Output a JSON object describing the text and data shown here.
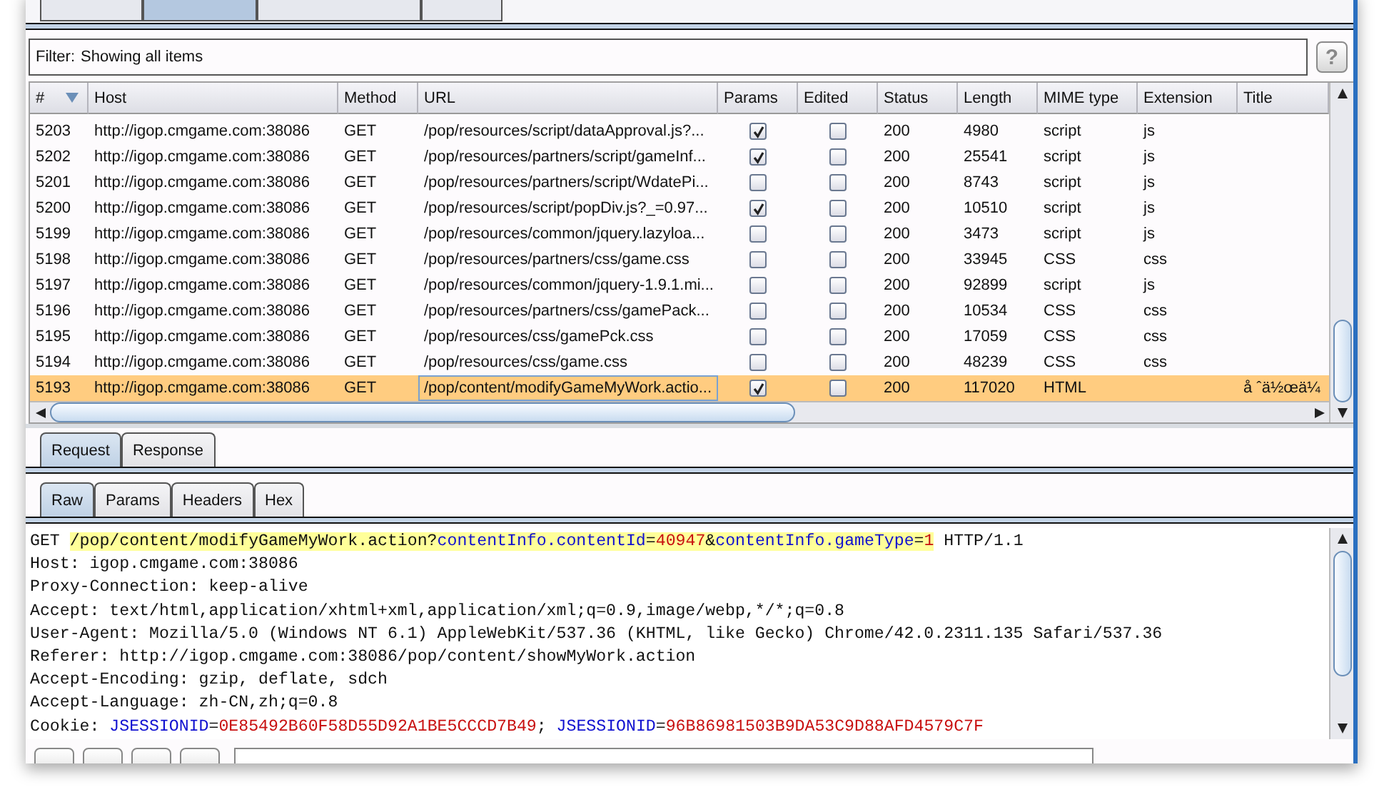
{
  "filter": {
    "label": "Filter:",
    "value": "Showing all items"
  },
  "help_button": "?",
  "top_tabs": [
    {
      "selected": false
    },
    {
      "selected": true
    },
    {
      "selected": false
    },
    {
      "selected": false
    }
  ],
  "table": {
    "columns": [
      {
        "label": "#",
        "sorted": true
      },
      {
        "label": "Host",
        "sorted": false
      },
      {
        "label": "Method",
        "sorted": false
      },
      {
        "label": "URL",
        "sorted": false
      },
      {
        "label": "Params",
        "sorted": false
      },
      {
        "label": "Edited",
        "sorted": false
      },
      {
        "label": "Status",
        "sorted": false
      },
      {
        "label": "Length",
        "sorted": false
      },
      {
        "label": "MIME type",
        "sorted": false
      },
      {
        "label": "Extension",
        "sorted": false
      },
      {
        "label": "Title",
        "sorted": false
      }
    ],
    "rows": [
      {
        "id": "5203",
        "host": "http://igop.cmgame.com:38086",
        "method": "GET",
        "url": "/pop/resources/script/dataApproval.js?...",
        "params": true,
        "edited": false,
        "status": "200",
        "length": "4980",
        "mime": "script",
        "extension": "js",
        "title": "",
        "selected": false
      },
      {
        "id": "5202",
        "host": "http://igop.cmgame.com:38086",
        "method": "GET",
        "url": "/pop/resources/partners/script/gameInf...",
        "params": true,
        "edited": false,
        "status": "200",
        "length": "25541",
        "mime": "script",
        "extension": "js",
        "title": "",
        "selected": false
      },
      {
        "id": "5201",
        "host": "http://igop.cmgame.com:38086",
        "method": "GET",
        "url": "/pop/resources/partners/script/WdatePi...",
        "params": false,
        "edited": false,
        "status": "200",
        "length": "8743",
        "mime": "script",
        "extension": "js",
        "title": "",
        "selected": false
      },
      {
        "id": "5200",
        "host": "http://igop.cmgame.com:38086",
        "method": "GET",
        "url": "/pop/resources/script/popDiv.js?_=0.97...",
        "params": true,
        "edited": false,
        "status": "200",
        "length": "10510",
        "mime": "script",
        "extension": "js",
        "title": "",
        "selected": false
      },
      {
        "id": "5199",
        "host": "http://igop.cmgame.com:38086",
        "method": "GET",
        "url": "/pop/resources/common/jquery.lazyloa...",
        "params": false,
        "edited": false,
        "status": "200",
        "length": "3473",
        "mime": "script",
        "extension": "js",
        "title": "",
        "selected": false
      },
      {
        "id": "5198",
        "host": "http://igop.cmgame.com:38086",
        "method": "GET",
        "url": "/pop/resources/partners/css/game.css",
        "params": false,
        "edited": false,
        "status": "200",
        "length": "33945",
        "mime": "CSS",
        "extension": "css",
        "title": "",
        "selected": false
      },
      {
        "id": "5197",
        "host": "http://igop.cmgame.com:38086",
        "method": "GET",
        "url": "/pop/resources/common/jquery-1.9.1.mi...",
        "params": false,
        "edited": false,
        "status": "200",
        "length": "92899",
        "mime": "script",
        "extension": "js",
        "title": "",
        "selected": false
      },
      {
        "id": "5196",
        "host": "http://igop.cmgame.com:38086",
        "method": "GET",
        "url": "/pop/resources/partners/css/gamePack...",
        "params": false,
        "edited": false,
        "status": "200",
        "length": "10534",
        "mime": "CSS",
        "extension": "css",
        "title": "",
        "selected": false
      },
      {
        "id": "5195",
        "host": "http://igop.cmgame.com:38086",
        "method": "GET",
        "url": "/pop/resources/css/gamePck.css",
        "params": false,
        "edited": false,
        "status": "200",
        "length": "17059",
        "mime": "CSS",
        "extension": "css",
        "title": "",
        "selected": false
      },
      {
        "id": "5194",
        "host": "http://igop.cmgame.com:38086",
        "method": "GET",
        "url": "/pop/resources/css/game.css",
        "params": false,
        "edited": false,
        "status": "200",
        "length": "48239",
        "mime": "CSS",
        "extension": "css",
        "title": "",
        "selected": false
      },
      {
        "id": "5193",
        "host": "http://igop.cmgame.com:38086",
        "method": "GET",
        "url": "/pop/content/modifyGameMyWork.actio...",
        "params": true,
        "edited": false,
        "status": "200",
        "length": "117020",
        "mime": "HTML",
        "extension": "",
        "title": "å ˆä½œä¼",
        "selected": true
      }
    ]
  },
  "message_tabs": [
    {
      "label": "Request",
      "selected": true
    },
    {
      "label": "Response",
      "selected": false
    }
  ],
  "view_tabs": [
    {
      "label": "Raw",
      "selected": true
    },
    {
      "label": "Params",
      "selected": false
    },
    {
      "label": "Headers",
      "selected": false
    },
    {
      "label": "Hex",
      "selected": false
    }
  ],
  "request_lines": [
    [
      {
        "text": "GET ",
        "kind": "plain",
        "highlighted": false
      },
      {
        "text": "/pop/content/modifyGameMyWork.action?",
        "kind": "plain",
        "highlighted": true
      },
      {
        "text": "contentInfo.contentId",
        "kind": "name",
        "highlighted": true
      },
      {
        "text": "=",
        "kind": "plain",
        "highlighted": true
      },
      {
        "text": "40947",
        "kind": "value",
        "highlighted": true
      },
      {
        "text": "&",
        "kind": "plain",
        "highlighted": true
      },
      {
        "text": "contentInfo.gameType",
        "kind": "name",
        "highlighted": true
      },
      {
        "text": "=",
        "kind": "plain",
        "highlighted": true
      },
      {
        "text": "1",
        "kind": "value",
        "highlighted": true
      },
      {
        "text": " HTTP/1.1",
        "kind": "plain",
        "highlighted": false
      }
    ],
    [
      {
        "text": "Host: igop.cmgame.com:38086",
        "kind": "plain",
        "highlighted": false
      }
    ],
    [
      {
        "text": "Proxy-Connection: keep-alive",
        "kind": "plain",
        "highlighted": false
      }
    ],
    [
      {
        "text": "Accept: text/html,application/xhtml+xml,application/xml;q=0.9,image/webp,*/*;q=0.8",
        "kind": "plain",
        "highlighted": false
      }
    ],
    [
      {
        "text": "User-Agent: Mozilla/5.0 (Windows NT 6.1) AppleWebKit/537.36 (KHTML, like Gecko) Chrome/42.0.2311.135 Safari/537.36",
        "kind": "plain",
        "highlighted": false
      }
    ],
    [
      {
        "text": "Referer: http://igop.cmgame.com:38086/pop/content/showMyWork.action",
        "kind": "plain",
        "highlighted": false
      }
    ],
    [
      {
        "text": "Accept-Encoding: gzip, deflate, sdch",
        "kind": "plain",
        "highlighted": false
      }
    ],
    [
      {
        "text": "Accept-Language: zh-CN,zh;q=0.8",
        "kind": "plain",
        "highlighted": false
      }
    ],
    [
      {
        "text": "Cookie: ",
        "kind": "plain",
        "highlighted": false
      },
      {
        "text": "JSESSIONID",
        "kind": "name",
        "highlighted": false
      },
      {
        "text": "=",
        "kind": "plain",
        "highlighted": false
      },
      {
        "text": "0E85492B60F58D55D92A1BE5CCCD7B49",
        "kind": "value",
        "highlighted": false
      },
      {
        "text": "; ",
        "kind": "plain",
        "highlighted": false
      },
      {
        "text": "JSESSIONID",
        "kind": "name",
        "highlighted": false
      },
      {
        "text": "=",
        "kind": "plain",
        "highlighted": false
      },
      {
        "text": "96B86981503B9DA53C9D88AFD4579C7F",
        "kind": "value",
        "highlighted": false
      }
    ]
  ]
}
